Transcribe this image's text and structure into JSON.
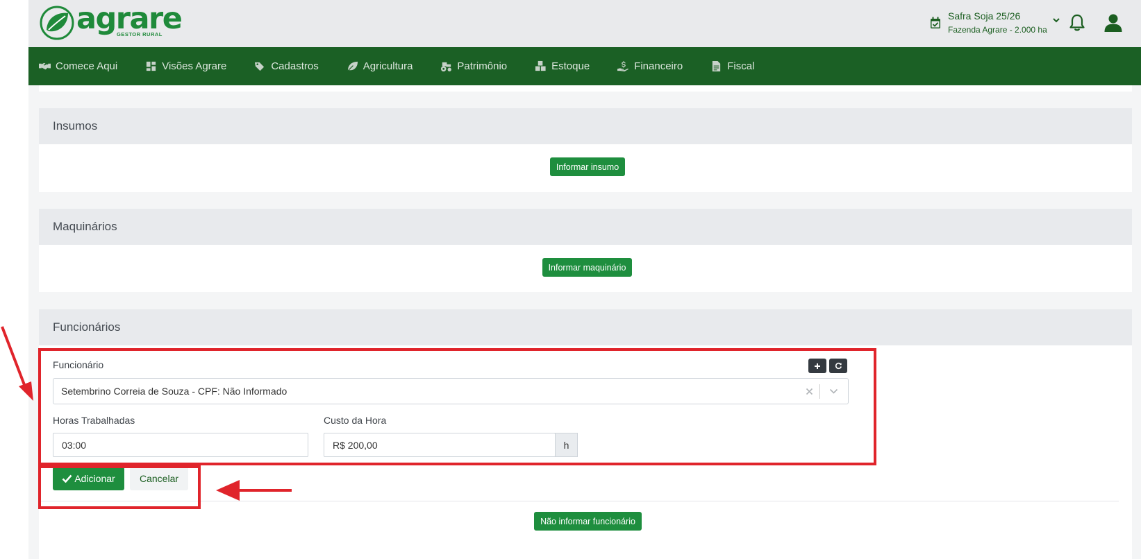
{
  "brand": {
    "name": "agrare",
    "subtitle": "GESTOR RURAL",
    "color": "#1f8a3a"
  },
  "header": {
    "safra_title": "Safra Soja 25/26",
    "safra_subtitle": "Fazenda Agrare - 2.000 ha"
  },
  "nav": {
    "items": [
      {
        "label": "Comece Aqui",
        "icon": "handshake-icon"
      },
      {
        "label": "Visões Agrare",
        "icon": "dashboard-icon"
      },
      {
        "label": "Cadastros",
        "icon": "tags-icon"
      },
      {
        "label": "Agricultura",
        "icon": "leaf-icon"
      },
      {
        "label": "Patrimônio",
        "icon": "tractor-icon"
      },
      {
        "label": "Estoque",
        "icon": "boxes-icon"
      },
      {
        "label": "Financeiro",
        "icon": "hand-money-icon"
      },
      {
        "label": "Fiscal",
        "icon": "file-invoice-icon"
      }
    ]
  },
  "sections": {
    "insumos": {
      "title": "Insumos",
      "button": "Informar insumo"
    },
    "maquinarios": {
      "title": "Maquinários",
      "button": "Informar maquinário"
    },
    "funcionarios": {
      "title": "Funcionários",
      "funcionario_label": "Funcionário",
      "funcionario_value": "Setembrino Correia de Souza - CPF: Não Informado",
      "horas_label": "Horas Trabalhadas",
      "horas_value": "03:00",
      "custo_label": "Custo da Hora",
      "custo_value": "R$ 200,00",
      "custo_addon": "h",
      "add_button": "Adicionar",
      "cancel_button": "Cancelar",
      "skip_button": "Não informar funcionário"
    }
  },
  "colors": {
    "nav_bg": "#1b6025",
    "primary_green": "#1e8e3e",
    "annotation_red": "#e0242b",
    "header_bg": "#e9eaec"
  }
}
